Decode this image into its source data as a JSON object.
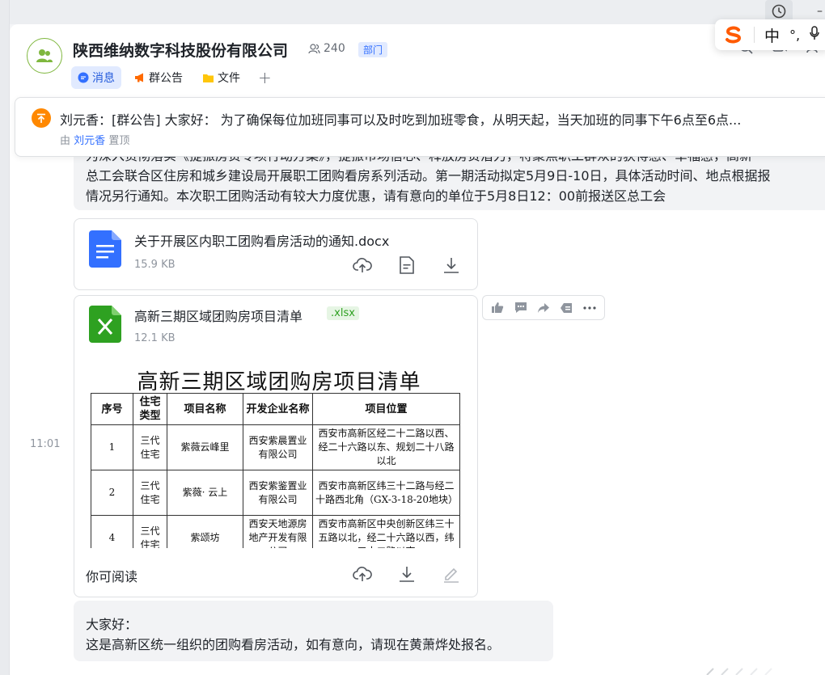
{
  "group": {
    "title": "陕西维纳数字科技股份有限公司",
    "member_count": "240",
    "badge": "部门"
  },
  "tabs": [
    {
      "label": "消息",
      "icon": "message-icon",
      "active": true
    },
    {
      "label": "群公告",
      "icon": "megaphone-icon",
      "active": false
    },
    {
      "label": "文件",
      "icon": "folder-icon",
      "active": false
    }
  ],
  "pinned": {
    "text": "刘元香：[群公告] 大家好： 为了确保每位加班同事可以及时吃到加班零食，从明天起，当天加班的同事下午6点至6点...",
    "by_prefix": "由",
    "by_name": "刘元香",
    "by_suffix": "置顶"
  },
  "top_message": {
    "lines": [
      "为深入贯彻落实《提振房贷专项行动方案》，提振市场信心、释放房贷潜力，将聚焦职工群众的获得感、幸福感，高新",
      "总工会联合区住房和城乡建设局开展职工团购看房系列活动。第一期活动拟定5月9日-10日，具体活动时间、地点根据报",
      "情况另行通知。本次职工团购活动有较大力度优惠，请有意向的单位于5月8日12：00前报送区总工会"
    ]
  },
  "docx_file": {
    "name": "关于开展区内职工团购看房活动的通知.docx",
    "size": "15.9 KB",
    "icon": "word-doc-icon"
  },
  "xlsx_file": {
    "name": "高新三期区域团购房项目清单",
    "ext": ".xlsx",
    "size": "12.1 KB",
    "icon": "excel-icon",
    "footer_label": "你可阅读"
  },
  "timestamp": "11:01",
  "preview": {
    "title": "高新三期区域团购房项目清单",
    "headers": [
      "序号",
      "住宅类型",
      "项目名称",
      "开发企业名称",
      "项目位置"
    ],
    "rows": [
      [
        "1",
        "三代住宅",
        "紫薇云峰里",
        "西安紫晨置业有限公司",
        "西安市高新区经二十二路以西、经二十六路以东、规划二十八路以北"
      ],
      [
        "2",
        "三代住宅",
        "紫薇· 云上",
        "西安紫鉴置业有限公司",
        "西安市高新区纬三十二路与经二十路西北角（GX-3-18-20地块）"
      ],
      [
        "4",
        "三代住宅",
        "紫颂坊",
        "西安天地源房地产开发有限公司",
        "西安市高新区中央创新区纬三十五路以北，经二十六路以西，纬三十二路以南"
      ]
    ]
  },
  "last_message": {
    "lines": [
      "大家好：",
      "这是高新区统一组织的团购看房活动，如有意向，请现在黄萧烨处报名。"
    ]
  },
  "ime": {
    "lang": "中",
    "punct": "°,"
  },
  "colors": {
    "accent": "#3370ff",
    "pin": "#ff8800",
    "word": "#3370ff",
    "excel": "#2ea121"
  }
}
